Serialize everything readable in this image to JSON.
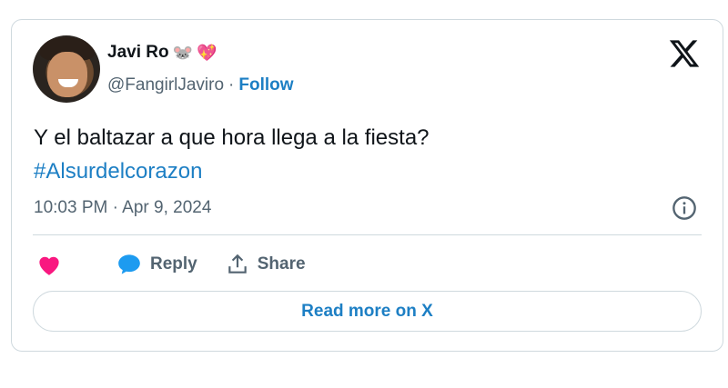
{
  "tweet": {
    "author_name": "Javi Ro",
    "author_emojis": [
      "🐭",
      "💖"
    ],
    "handle": "@FangirlJaviro",
    "separator": "·",
    "follow_label": "Follow",
    "text": "Y el baltazar a que hora llega a la fiesta?",
    "hashtag": "#Alsurdelcorazon",
    "timestamp": "10:03 PM · Apr 9, 2024"
  },
  "actions": {
    "like_icon": "heart-icon",
    "reply_label": "Reply",
    "share_label": "Share"
  },
  "footer": {
    "read_more_label": "Read more on X"
  },
  "colors": {
    "link": "#1d7fc4",
    "heart": "#f91880",
    "reply_bubble": "#1d9bf0",
    "border": "#cfd9de",
    "muted": "#536471"
  }
}
